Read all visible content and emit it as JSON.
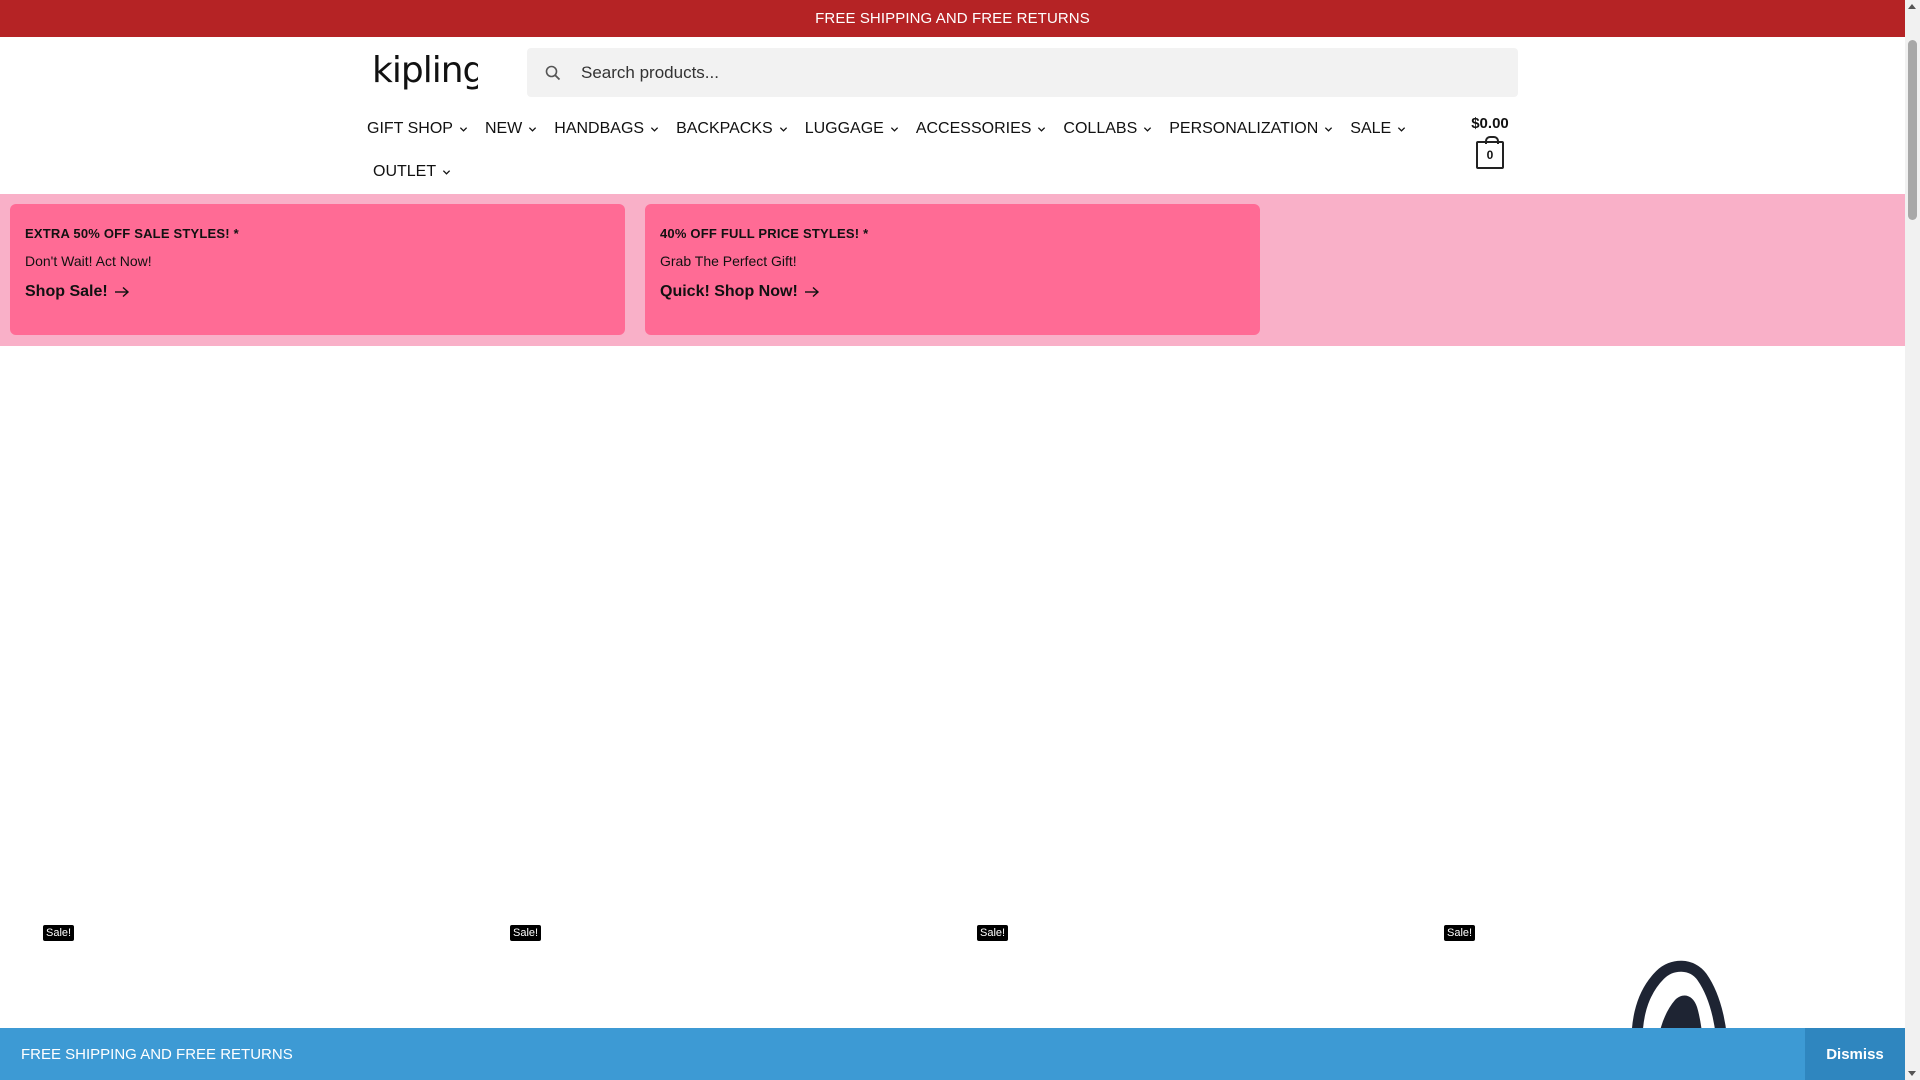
{
  "announcement": {
    "text": "FREE SHIPPING AND FREE RETURNS"
  },
  "header": {
    "logo_text": "kipling",
    "search": {
      "placeholder": "Search products..."
    }
  },
  "nav": {
    "items": [
      {
        "label": "GIFT SHOP"
      },
      {
        "label": "NEW"
      },
      {
        "label": "HANDBAGS"
      },
      {
        "label": "BACKPACKS"
      },
      {
        "label": "LUGGAGE"
      },
      {
        "label": "ACCESSORIES"
      },
      {
        "label": "COLLABS"
      },
      {
        "label": "PERSONALIZATION"
      },
      {
        "label": "SALE"
      },
      {
        "label": "OUTLET"
      }
    ]
  },
  "cart": {
    "amount": "$0.00",
    "count": "0"
  },
  "promos": [
    {
      "title": "EXTRA 50% OFF SALE STYLES! *",
      "subtitle": "Don't Wait! Act Now!",
      "link": "Shop Sale!"
    },
    {
      "title": "40% OFF FULL PRICE STYLES! *",
      "subtitle": "Grab The Perfect Gift!",
      "link": "Quick! Shop Now!"
    }
  ],
  "products": {
    "badges": [
      "Sale!",
      "Sale!",
      "Sale!",
      "Sale!"
    ]
  },
  "store_notice": {
    "text": "FREE SHIPPING AND FREE RETURNS",
    "dismiss": "Dismiss"
  },
  "colors": {
    "announcement_bg": "#b52325",
    "promo_band_bg": "#f9b0c8",
    "promo_card_bg": "#ff6b95",
    "notice_bg": "#3d9ad4"
  }
}
